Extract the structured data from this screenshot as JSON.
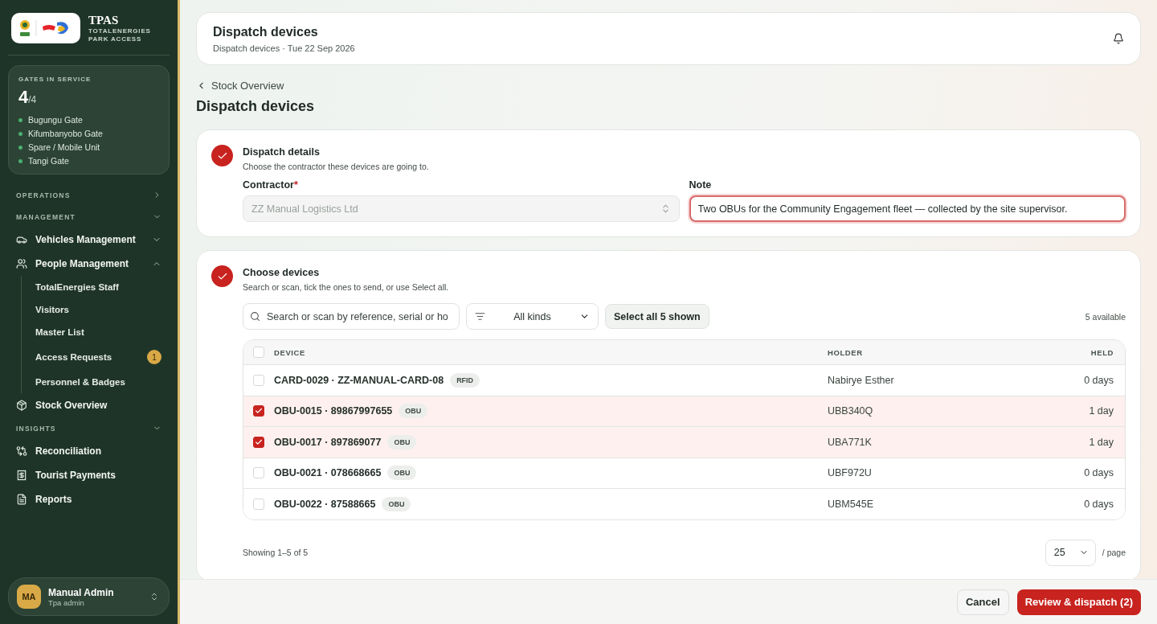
{
  "brand": {
    "name": "TPAS",
    "subtitle": "TOTALENERGIES PARK ACCESS"
  },
  "gates": {
    "label": "GATES IN SERVICE",
    "count": "4",
    "total": "/4",
    "items": [
      {
        "name": "Bugungu Gate"
      },
      {
        "name": "Kifumbanyobo Gate"
      },
      {
        "name": "Spare / Mobile Unit"
      },
      {
        "name": "Tangi Gate"
      }
    ]
  },
  "nav": [
    {
      "kind": "section",
      "label": "OPERATIONS",
      "expanded": false
    },
    {
      "kind": "section",
      "label": "MANAGEMENT",
      "expanded": true
    },
    {
      "kind": "item",
      "label": "Vehicles Management",
      "expanded": false
    },
    {
      "kind": "item",
      "label": "People Management",
      "expanded": true,
      "children": [
        {
          "label": "TotalEnergies Staff"
        },
        {
          "label": "Visitors"
        },
        {
          "label": "Master List"
        },
        {
          "label": "Access Requests",
          "badge": "1"
        },
        {
          "label": "Personnel & Badges"
        }
      ]
    },
    {
      "kind": "item",
      "label": "Stock Overview"
    },
    {
      "kind": "section",
      "label": "INSIGHTS",
      "expanded": true
    },
    {
      "kind": "item",
      "label": "Reconciliation"
    },
    {
      "kind": "item",
      "label": "Tourist Payments"
    },
    {
      "kind": "item",
      "label": "Reports"
    }
  ],
  "user": {
    "initials": "MA",
    "name": "Manual Admin",
    "role": "Tpa admin"
  },
  "header": {
    "title": "Dispatch devices",
    "subtitle": "Dispatch devices · Tue 22 Sep 2026"
  },
  "back_link": "Stock Overview",
  "page_title": "Dispatch devices",
  "details": {
    "title": "Dispatch details",
    "description": "Choose the contractor these devices are going to.",
    "done": true,
    "contractor": {
      "label": "Contractor",
      "required_mark": "*",
      "value": "ZZ Manual Logistics Ltd",
      "disabled": true
    },
    "note": {
      "label": "Note",
      "value": "Two OBUs for the Community Engagement fleet — collected by the site supervisor.",
      "focused": true
    }
  },
  "devices": {
    "title": "Choose devices",
    "description": "Search or scan, tick the ones to send, or use Select all.",
    "done": true,
    "search": {
      "placeholder": "Search or scan by reference, serial or ho"
    },
    "filter": "All kinds",
    "select_all": "Select all 5 shown",
    "available": "5 available",
    "table": {
      "columns": [
        "DEVICE",
        "HOLDER",
        "HELD"
      ],
      "all_checked": false,
      "rows": [
        {
          "reference": "CARD-0029 · ZZ-MANUAL-CARD-08",
          "tag": "RFID",
          "holder": "Nabirye Esther",
          "held": "0 days",
          "checked": false
        },
        {
          "reference": "OBU-0015 · 89867997655",
          "tag": "OBU",
          "holder": "UBB340Q",
          "held": "1 day",
          "checked": true
        },
        {
          "reference": "OBU-0017 · 897869077",
          "tag": "OBU",
          "holder": "UBA771K",
          "held": "1 day",
          "checked": true
        },
        {
          "reference": "OBU-0021 · 078668665",
          "tag": "OBU",
          "holder": "UBF972U",
          "held": "0 days",
          "checked": false
        },
        {
          "reference": "OBU-0022 · 87588665",
          "tag": "OBU",
          "holder": "UBM545E",
          "held": "0 days",
          "checked": false
        }
      ]
    },
    "showing": "Showing 1–5 of 5",
    "page_size": "25",
    "per_page": "/ page"
  },
  "footer": {
    "cancel": "Cancel",
    "submit": "Review & dispatch (2)"
  }
}
